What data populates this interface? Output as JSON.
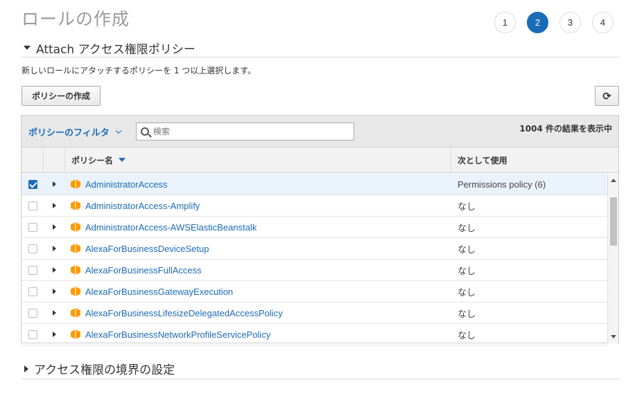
{
  "page": {
    "title": "ロールの作成",
    "steps": [
      "1",
      "2",
      "3",
      "4"
    ],
    "active_step": "2"
  },
  "attach_section": {
    "title": "Attach アクセス権限ポリシー",
    "description": "新しいロールにアタッチするポリシーを 1 つ以上選択します。",
    "create_policy_label": "ポリシーの作成",
    "refresh_icon": "refresh-icon"
  },
  "filter": {
    "label": "ポリシーのフィルタ",
    "search_placeholder": "検索",
    "result_count": "1004 件の結果を表示中"
  },
  "table": {
    "columns": [
      "ポリシー名",
      "次として使用"
    ],
    "rows": [
      {
        "name": "AdministratorAccess",
        "usage": "Permissions policy (6)",
        "checked": true
      },
      {
        "name": "AdministratorAccess-Amplify",
        "usage": "なし",
        "checked": false
      },
      {
        "name": "AdministratorAccess-AWSElasticBeanstalk",
        "usage": "なし",
        "checked": false
      },
      {
        "name": "AlexaForBusinessDeviceSetup",
        "usage": "なし",
        "checked": false
      },
      {
        "name": "AlexaForBusinessFullAccess",
        "usage": "なし",
        "checked": false
      },
      {
        "name": "AlexaForBusinessGatewayExecution",
        "usage": "なし",
        "checked": false
      },
      {
        "name": "AlexaForBusinessLifesizeDelegatedAccessPolicy",
        "usage": "なし",
        "checked": false
      },
      {
        "name": "AlexaForBusinessNetworkProfileServicePolicy",
        "usage": "なし",
        "checked": false
      }
    ]
  },
  "boundary_section": {
    "title": "アクセス権限の境界の設定"
  },
  "colors": {
    "accent": "#1a6bb8",
    "policy_icon": "#ff9900",
    "selected_row": "#eaf3fc"
  }
}
